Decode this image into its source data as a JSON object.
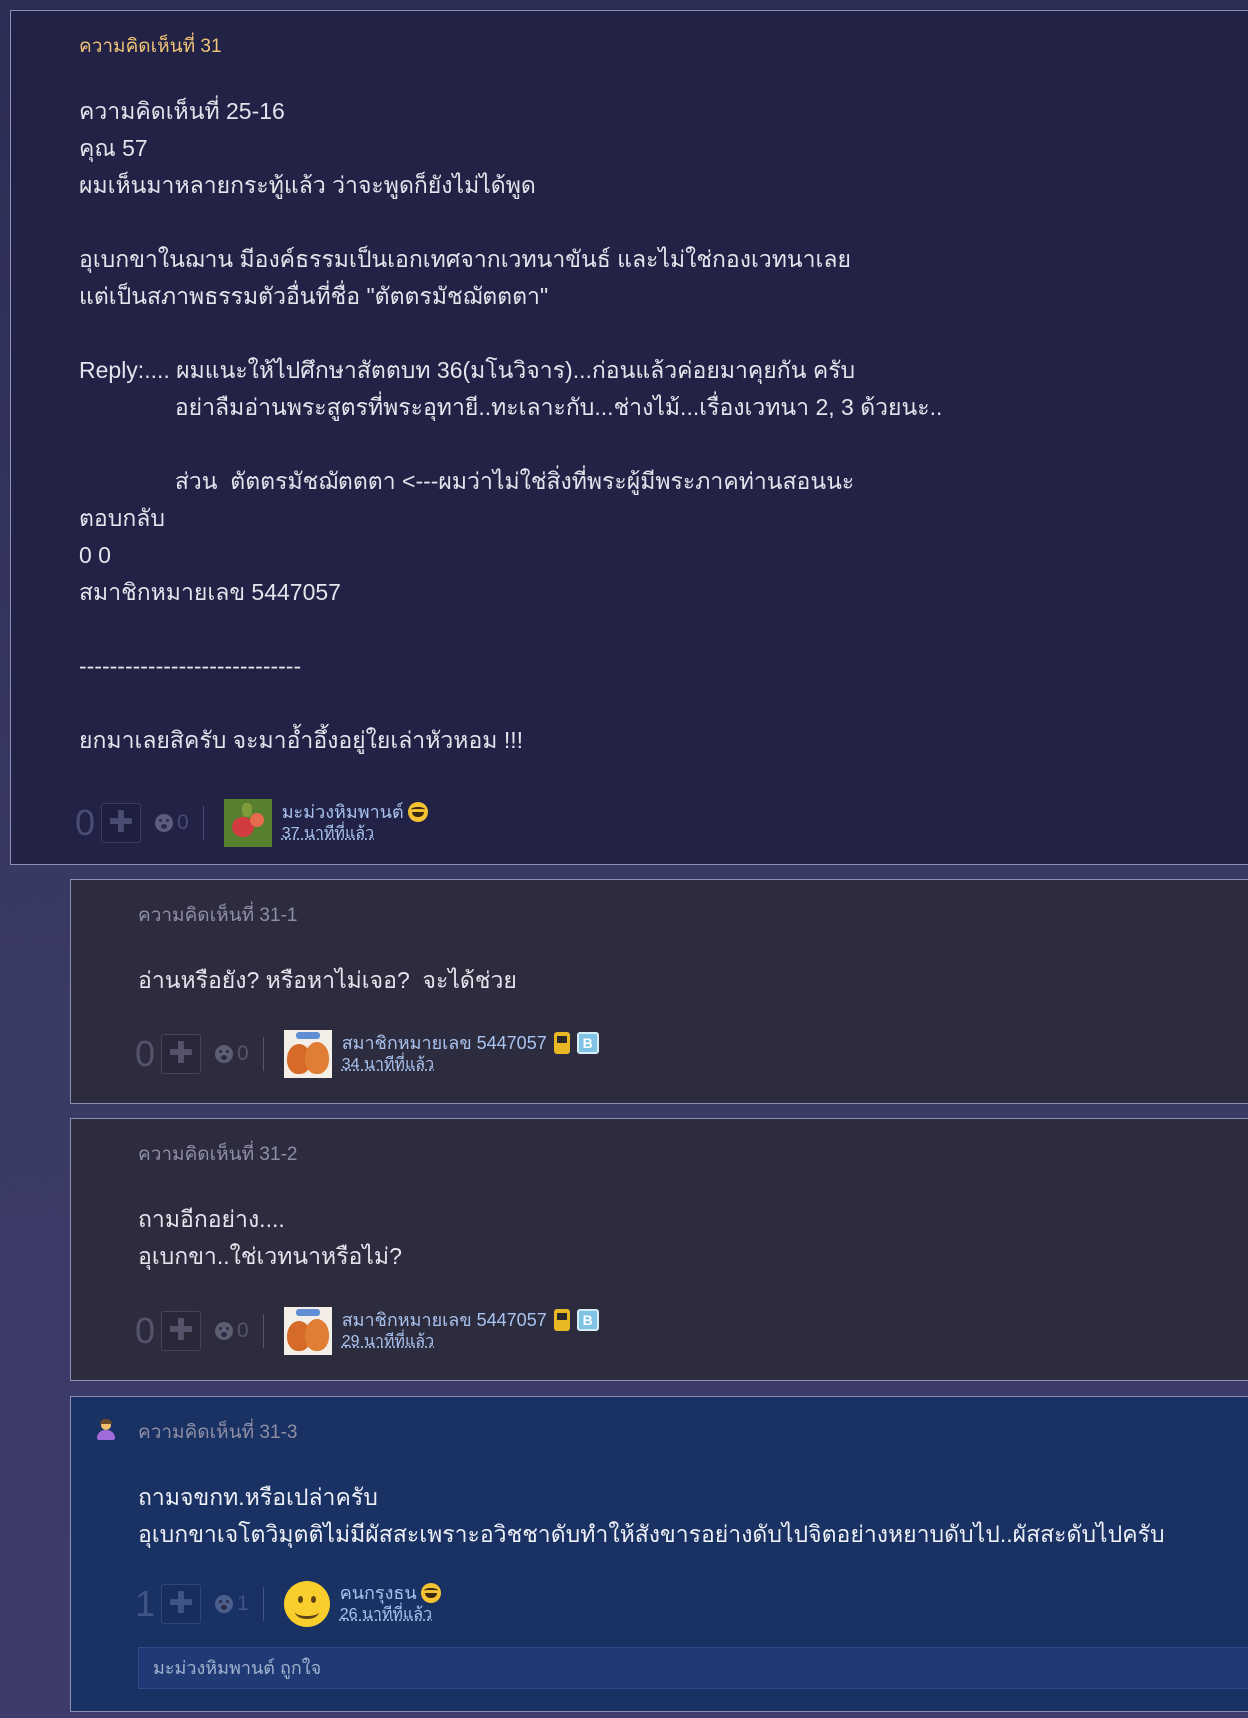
{
  "comments": [
    {
      "header": "ความคิดเห็นที่ 31",
      "body": "ความคิดเห็นที่ 25-16\nคุณ 57\nผมเห็นมาหลายกระทู้แล้ว ว่าจะพูดก็ยังไม่ได้พูด\n\nอุเบกขาในฌาน มีองค์ธรรมเป็นเอกเทศจากเวทนาขันธ์ และไม่ใช่กองเวทนาเลย\nแต่เป็นสภาพธรรมตัวอื่นที่ชื่อ \"ตัตตรมัชฌัตตตา\"\n\nReply:.... ผมแนะให้ไปศึกษาสัตตบท 36(มโนวิจาร)...ก่อนแล้วค่อยมาคุยกัน ครับ\n               อย่าลืมอ่านพระสูตรที่พระอุทายี..ทะเลาะกับ...ช่างไม้...เรื่องเวทนา 2, 3 ด้วยนะ..\n\n               ส่วน  ตัตตรมัชฌัตตตา <---ผมว่าไม่ใช่สิ่งที่พระผู้มีพระภาคท่านสอนนะ\nตอบกลับ\n0 0\nสมาชิกหมายเลข 5447057\n\n-----------------------------\n\nยกมาเลยสิครับ จะมาอ้ำอึ้งอยู่ใยเล่าหัวหอม !!!",
      "votes": "0",
      "emotions": "0",
      "author": "มะม่วงหิมพานต์",
      "time": "37 นาทีที่แล้ว",
      "avatar": "cashew-fruit-avatar",
      "badges": [
        "laughing-face-icon"
      ]
    },
    {
      "header": "ความคิดเห็นที่ 31-1",
      "body": "อ่านหรือยัง? หรือหาไม่เจอ?  จะได้ช่วย",
      "votes": "0",
      "emotions": "0",
      "author": "สมาชิกหมายเลข 5447057",
      "time": "34 นาทีที่แล้ว",
      "avatar": "onion-avatar",
      "badges": [
        "phone-icon",
        "blog-b-icon"
      ]
    },
    {
      "header": "ความคิดเห็นที่ 31-2",
      "body": "ถามอีกอย่าง....\nอุเบกขา..ใช่เวทนาหรือไม่?",
      "votes": "0",
      "emotions": "0",
      "author": "สมาชิกหมายเลข 5447057",
      "time": "29 นาทีที่แล้ว",
      "avatar": "onion-avatar",
      "badges": [
        "phone-icon",
        "blog-b-icon"
      ]
    },
    {
      "header": "ความคิดเห็นที่ 31-3",
      "body": "ถามจขกท.หรือเปล่าครับ\nอุเบกขาเจโตวิมุตติไม่มีผัสสะเพราะอวิชชาดับทำให้สังขารอย่างดับไปจิตอย่างหยาบดับไป..ผัสสะดับไปครับ",
      "votes": "1",
      "emotions": "1",
      "author": "คนกรุงธน",
      "time": "26 นาทีที่แล้ว",
      "avatar": "smiley-avatar",
      "badges": [
        "laughing-face-icon"
      ],
      "liked_by": "มะม่วงหิมพานต์ ถูกใจ"
    }
  ],
  "colors": {
    "main_bg": "#212245",
    "reply_bg": "#2d2c3e",
    "highlight_reply_bg": "#193163",
    "header_accent": "#f0c277",
    "link": "#a9c3f0"
  }
}
